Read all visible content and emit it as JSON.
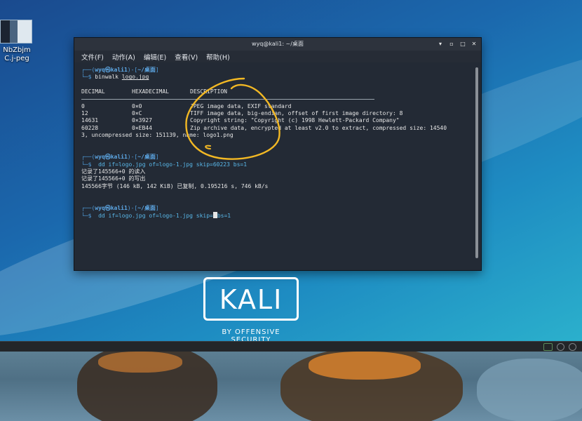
{
  "desktop": {
    "file_icon_label": "NbZbjmC.j-peg"
  },
  "terminal": {
    "title": "wyq@kali1: ~/桌面",
    "window_buttons": {
      "minimize": "▾",
      "maximize": "▫",
      "restore": "□",
      "close": "✕"
    },
    "menu": [
      "文件(F)",
      "动作(A)",
      "编辑(E)",
      "查看(V)",
      "帮助(H)"
    ],
    "prompt1": {
      "user": "wyq㉿kali1",
      "dir": "~/桌面",
      "command": "binwalk",
      "arg": "logo.jpg"
    },
    "binwalk": {
      "headers": [
        "DECIMAL",
        "HEXADECIMAL",
        "DESCRIPTION"
      ],
      "rows": [
        [
          "0",
          "0×0",
          "JPEG image data, EXIF standard"
        ],
        [
          "12",
          "0×C",
          "TIFF image data, big-endian, offset of first image directory: 8"
        ],
        [
          "14631",
          "0×3927",
          "Copyright string: \"Copyright (c) 1998 Hewlett-Packard Company\""
        ],
        [
          "60228",
          "0×EB44",
          "Zip archive data, encrypted at least v2.0 to extract, compressed size: 14540"
        ]
      ],
      "wrap_line": "3, uncompressed size: 151139, name: logo1.png"
    },
    "prompt2": {
      "user": "wyq㉿kali1",
      "dir": "~/桌面",
      "command": "dd if=logo.jpg of=logo-1.jpg skip=60223 bs=1"
    },
    "dd_output": [
      "记录了145566+0 的读入",
      "记录了145566+0 的写出",
      "145566字节 (146 kB, 142 KiB) 已复制, 0.195216 s, 746 kB/s"
    ],
    "prompt3": {
      "user": "wyq㉿kali1",
      "dir": "~/桌面",
      "cmd_before": "dd if=logo.jpg of=logo-1.jpg skip=",
      "cmd_after": "bs=1"
    }
  },
  "logo": {
    "name": "KALI",
    "tagline": "BY OFFENSIVE SECURITY"
  },
  "colors": {
    "terminal_bg": "#232a35",
    "prompt_blue": "#4f9bd8",
    "annotation": "#f2b824"
  }
}
